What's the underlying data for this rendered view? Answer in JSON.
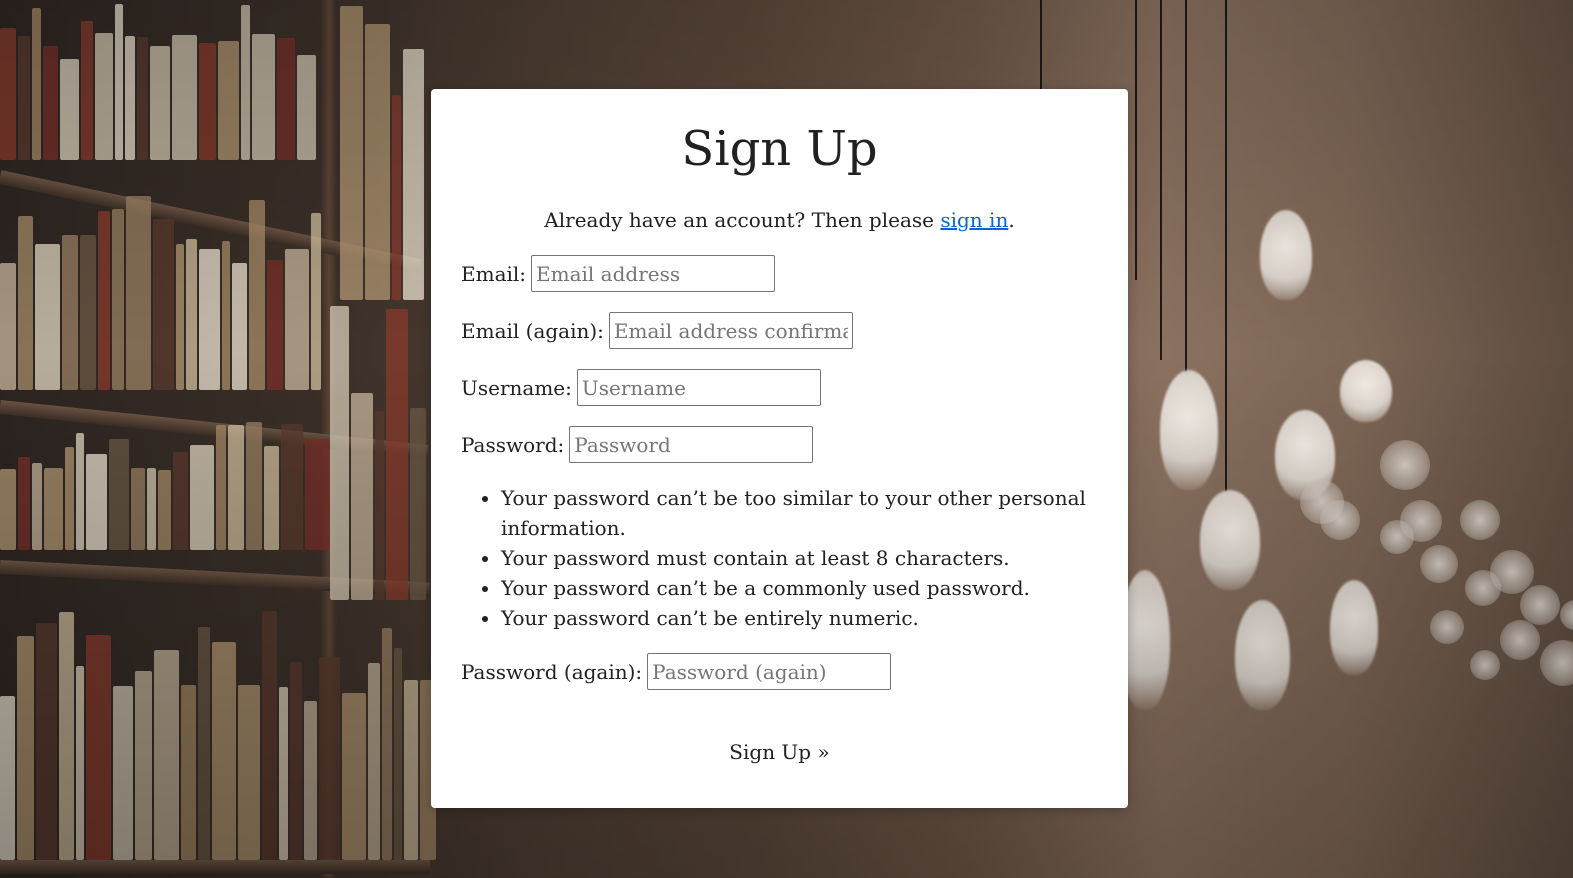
{
  "form": {
    "title": "Sign Up",
    "intro_text": "Already have an account? Then please ",
    "signin_link": "sign in",
    "intro_end": ".",
    "fields": {
      "email": {
        "label": "Email:",
        "placeholder": "Email address",
        "value": ""
      },
      "email2": {
        "label": "Email (again):",
        "placeholder": "Email address confirmation",
        "value": ""
      },
      "username": {
        "label": "Username:",
        "placeholder": "Username",
        "value": ""
      },
      "password": {
        "label": "Password:",
        "placeholder": "Password",
        "value": ""
      },
      "password2": {
        "label": "Password (again):",
        "placeholder": "Password (again)",
        "value": ""
      }
    },
    "password_rules": [
      "Your password can’t be too similar to your other personal information.",
      "Your password must contain at least 8 characters.",
      "Your password can’t be a commonly used password.",
      "Your password can’t be entirely numeric."
    ],
    "submit_label": "Sign Up »"
  },
  "colors": {
    "link": "#0d63d6",
    "card_bg": "#ffffff",
    "text": "#212121"
  }
}
